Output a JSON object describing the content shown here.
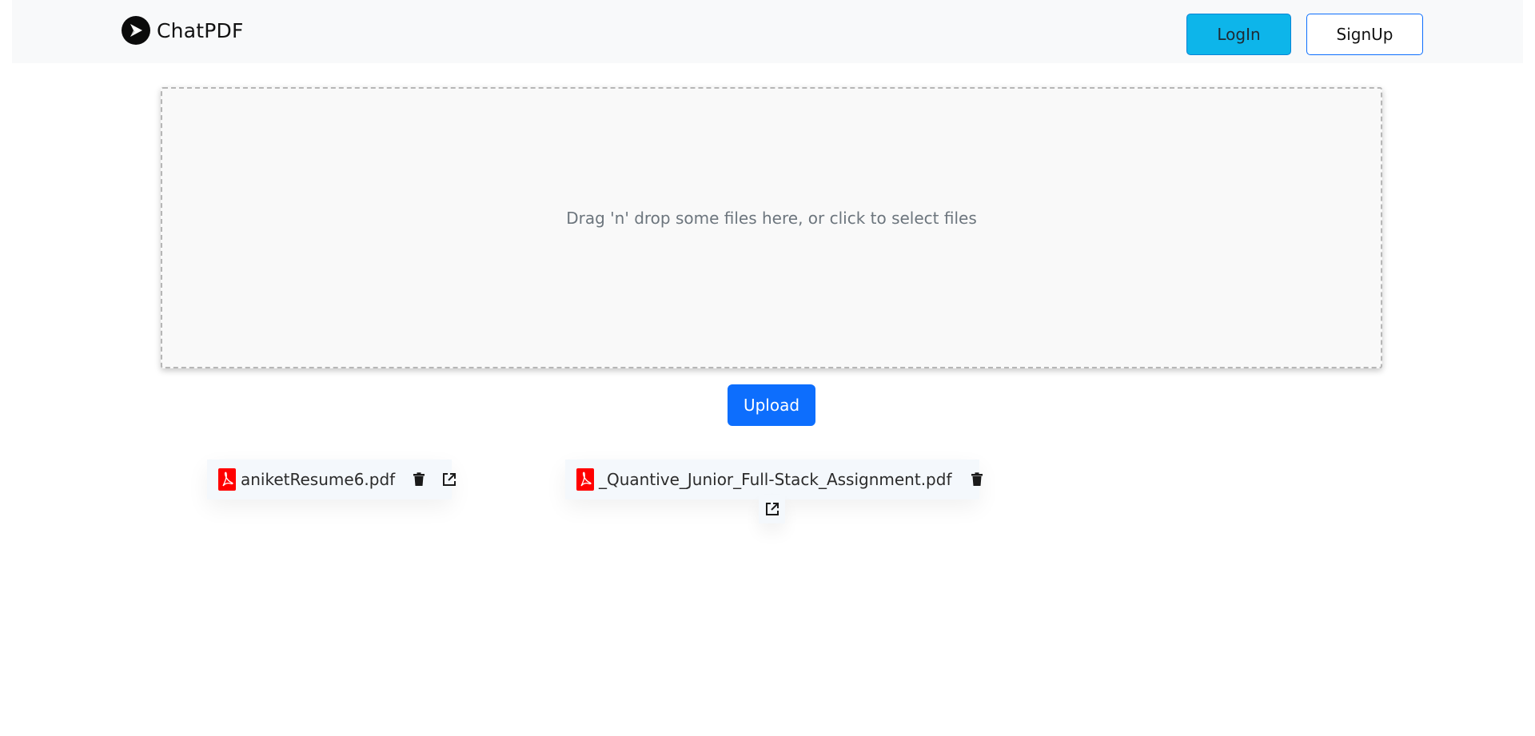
{
  "header": {
    "brand_name": "ChatPDF",
    "login_label": "LogIn",
    "signup_label": "SignUp"
  },
  "dropzone": {
    "text": "Drag 'n' drop some files here, or click to select files"
  },
  "upload_label": "Upload",
  "files": [
    {
      "name": "aniketResume6.pdf"
    },
    {
      "name": "_Quantive_Junior_Full-Stack_Assignment.pdf"
    }
  ],
  "icons": {
    "brand": "send-arrow-icon",
    "file": "pdf-file-icon",
    "delete": "trash-icon",
    "open": "external-link-icon"
  },
  "colors": {
    "login_bg": "#0db5ea",
    "signup_border": "#0d6efd",
    "upload_bg": "#0d6efd",
    "pdf_red": "#ff0000",
    "navbar_bg": "#f8f9fa",
    "dropzone_bg": "#f9f9f9"
  }
}
